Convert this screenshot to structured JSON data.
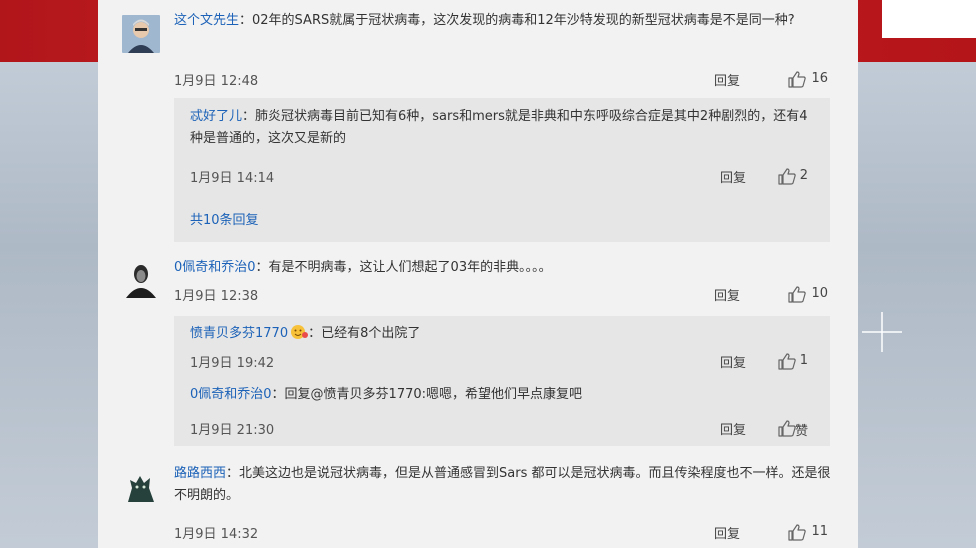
{
  "comments": [
    {
      "user": "这个文先生",
      "text": "：02年的SARS就属于冠状病毒，这次发现的病毒和12年沙特发现的新型冠状病毒是不是同一种?",
      "time": "1月9日 12:48",
      "reply_label": "回复",
      "likes": "16",
      "replies": [
        {
          "user": "忒好了儿",
          "text": "：肺炎冠状病毒目前已知有6种，sars和mers就是非典和中东呼吸综合症是其中2种剧烈的，还有4种是普通的，这次又是新的",
          "time": "1月9日 14:14",
          "reply_label": "回复",
          "likes": "2"
        }
      ],
      "more_replies": "共10条回复"
    },
    {
      "user": "0佩奇和乔治0",
      "text": "：有是不明病毒，这让人们想起了03年的非典。。。。",
      "time": "1月9日 12:38",
      "reply_label": "回复",
      "likes": "10",
      "replies": [
        {
          "user": "愤青贝多芬1770",
          "text": "：已经有8个出院了",
          "time": "1月9日 19:42",
          "reply_label": "回复",
          "likes": "1"
        },
        {
          "user": "0佩奇和乔治0",
          "text": "：回复@愤青贝多芬1770:嗯嗯，希望他们早点康复吧",
          "time": "1月9日 21:30",
          "reply_label": "回复",
          "likes": "赞"
        }
      ]
    },
    {
      "user": "路路西西",
      "text": "：北美这边也是说冠状病毒，但是从普通感冒到Sars 都可以是冠状病毒。而且传染程度也不一样。还是很不明朗的。",
      "time": "1月9日 14:32",
      "reply_label": "回复",
      "likes": "11"
    }
  ],
  "colors": {
    "username": "#1c62b8",
    "panel_bg": "#f2f2f2",
    "reply_bg": "#e6e6e6",
    "header_red": "#c51d22"
  },
  "icons": {
    "like": "thumbs-up-icon"
  }
}
